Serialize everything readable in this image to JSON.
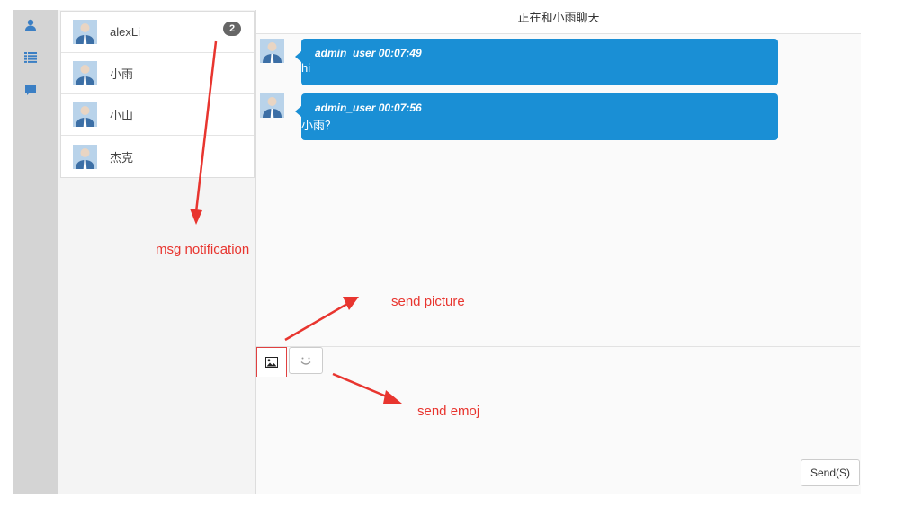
{
  "nav": {
    "items": [
      {
        "icon": "user-icon"
      },
      {
        "icon": "list-icon"
      },
      {
        "icon": "chat-bubble-icon"
      }
    ]
  },
  "contacts": [
    {
      "name": "alexLi",
      "badge": "2"
    },
    {
      "name": "小雨",
      "badge": ""
    },
    {
      "name": "小山",
      "badge": ""
    },
    {
      "name": "杰克",
      "badge": ""
    }
  ],
  "chat": {
    "header": "正在和小雨聊天",
    "messages": [
      {
        "sender": "admin_user",
        "time": "00:07:49",
        "meta": "admin_user 00:07:49",
        "text": "hi"
      },
      {
        "sender": "admin_user",
        "time": "00:07:56",
        "meta": "admin_user 00:07:56",
        "text": "小雨？"
      }
    ],
    "toolbar": {
      "picture_icon": "image-icon",
      "emoji_icon": "smiley-icon"
    },
    "input": {
      "value": "",
      "placeholder": ""
    },
    "send_label": "Send(S)"
  },
  "annotations": {
    "msg_notification": "msg notification",
    "send_picture": "send picture",
    "send_emoj": "send emoj",
    "color": "#e8352f"
  },
  "colors": {
    "bubble": "#1a8fd5",
    "rail": "#d4d4d4",
    "nav_icon": "#3b7fc4"
  }
}
